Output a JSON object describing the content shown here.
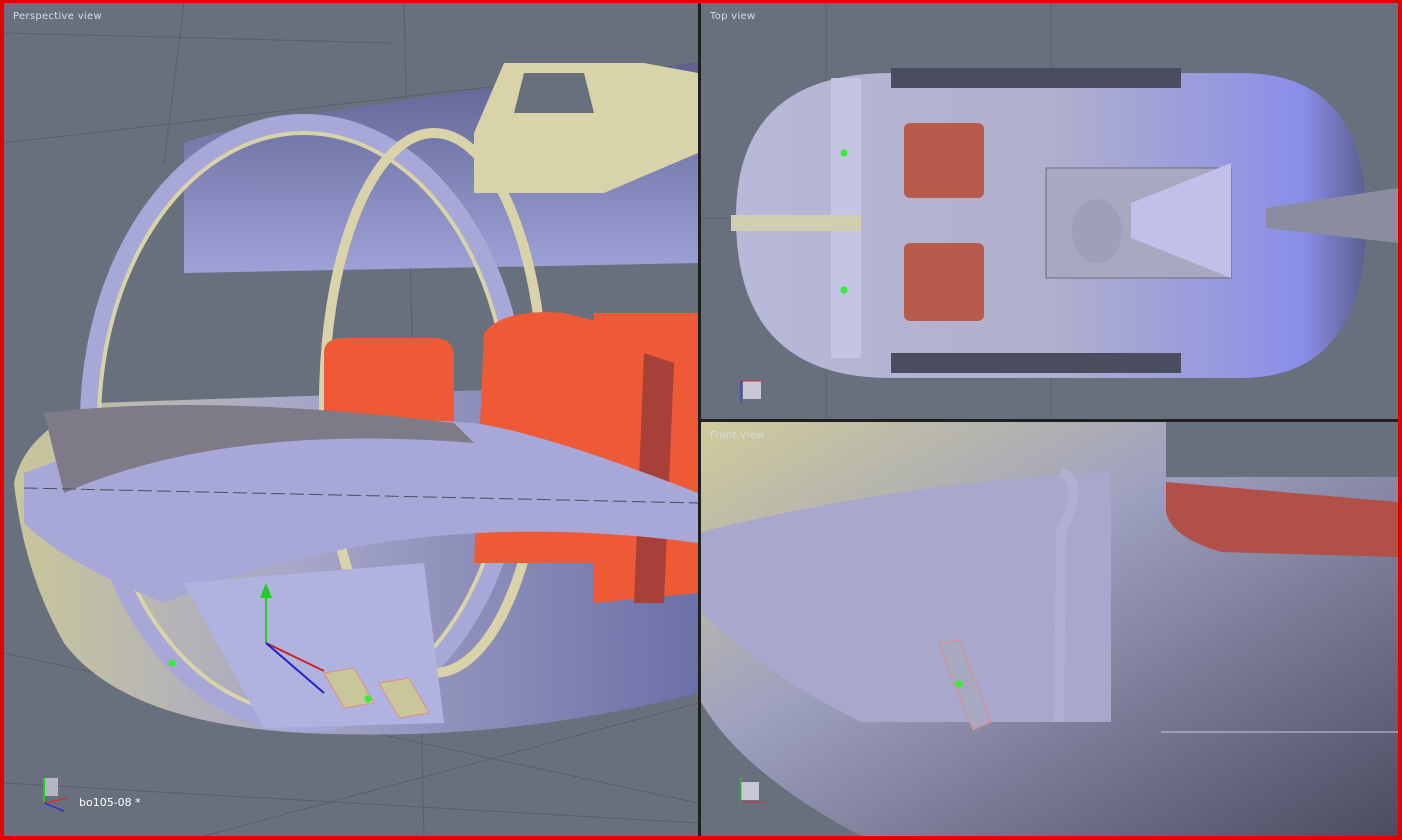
{
  "viewports": {
    "perspective": {
      "label": "Perspective view"
    },
    "top": {
      "label": "Top view"
    },
    "front": {
      "label": "Front view"
    }
  },
  "document": {
    "name": "bo105-08 *"
  },
  "axes": {
    "x": "x",
    "y": "y",
    "z": "z"
  },
  "colors": {
    "window_border": "#e00000",
    "viewport_bg": "#68707e",
    "hull": "#9a9ccc",
    "frame": "#d8d3a8",
    "seat": "#ee5a35"
  }
}
